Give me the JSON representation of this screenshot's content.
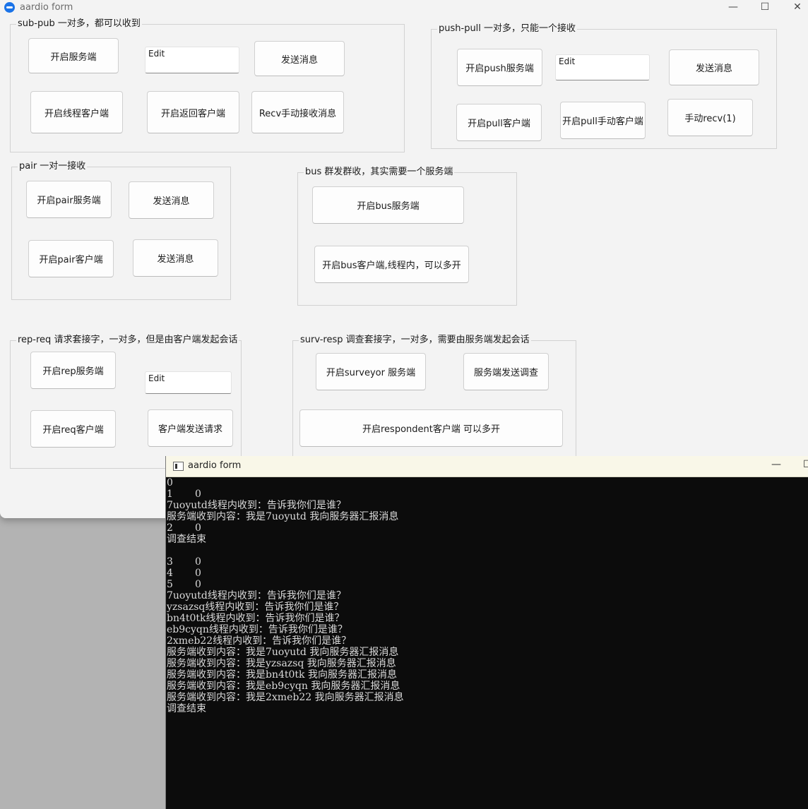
{
  "window": {
    "title": "aardio form",
    "minimize": "—",
    "maximize": "☐",
    "close": "✕"
  },
  "groups": {
    "subpub": {
      "label": "sub-pub 一对多，都可以收到",
      "start_server": "开启服务端",
      "edit": "Edit",
      "send": "发送消息",
      "start_thread_client": "开启线程客户端",
      "start_return_client": "开启返回客户端",
      "recv_manual": "Recv手动接收消息"
    },
    "pushpull": {
      "label": "push-pull 一对多，只能一个接收",
      "start_push_server": "开启push服务端",
      "edit": "Edit",
      "send": "发送消息",
      "start_pull_client": "开启pull客户端",
      "start_pull_manual_client": "开启pull手动客户端",
      "manual_recv": "手动recv(1)"
    },
    "pair": {
      "label": "pair  一对一接收",
      "start_server": "开启pair服务端",
      "send1": "发送消息",
      "start_client": "开启pair客户端",
      "send2": "发送消息"
    },
    "bus": {
      "label": "bus  群发群收，其实需要一个服务端",
      "start_server": "开启bus服务端",
      "start_client": "开启bus客户端,线程内，可以多开"
    },
    "repreq": {
      "label": "rep-req 请求套接字，一对多，但是由客户端发起会话",
      "start_rep": "开启rep服务端",
      "edit": "Edit",
      "start_req": "开启req客户端",
      "client_send": "客户端发送请求"
    },
    "survresp": {
      "label": "surv-resp 调查套接字，一对多，需要由服务端发起会话",
      "start_surveyor": "开启surveyor 服务端",
      "server_send": "服务端发送调查",
      "start_respondent": "开启respondent客户端 可以多开"
    }
  },
  "console": {
    "title": "aardio form",
    "minimize": "—",
    "maximize": "☐",
    "lines": [
      "0",
      "1       0",
      "7uoyutd线程内收到：告诉我你们是谁？",
      "服务端收到内容：我是7uoyutd 我向服务器汇报消息",
      "2       0",
      "调查结束",
      "",
      "3       0",
      "4       0",
      "5       0",
      "7uoyutd线程内收到：告诉我你们是谁？",
      "yzsazsq线程内收到：告诉我你们是谁？",
      "bn4t0tk线程内收到：告诉我你们是谁？",
      "eb9cyqn线程内收到：告诉我你们是谁？",
      "2xmeb22线程内收到：告诉我你们是谁？",
      "服务端收到内容：我是7uoyutd 我向服务器汇报消息",
      "服务端收到内容：我是yzsazsq 我向服务器汇报消息",
      "服务端收到内容：我是bn4t0tk 我向服务器汇报消息",
      "服务端收到内容：我是eb9cyqn 我向服务器汇报消息",
      "服务端收到内容：我是2xmeb22 我向服务器汇报消息",
      "调查结束"
    ]
  }
}
